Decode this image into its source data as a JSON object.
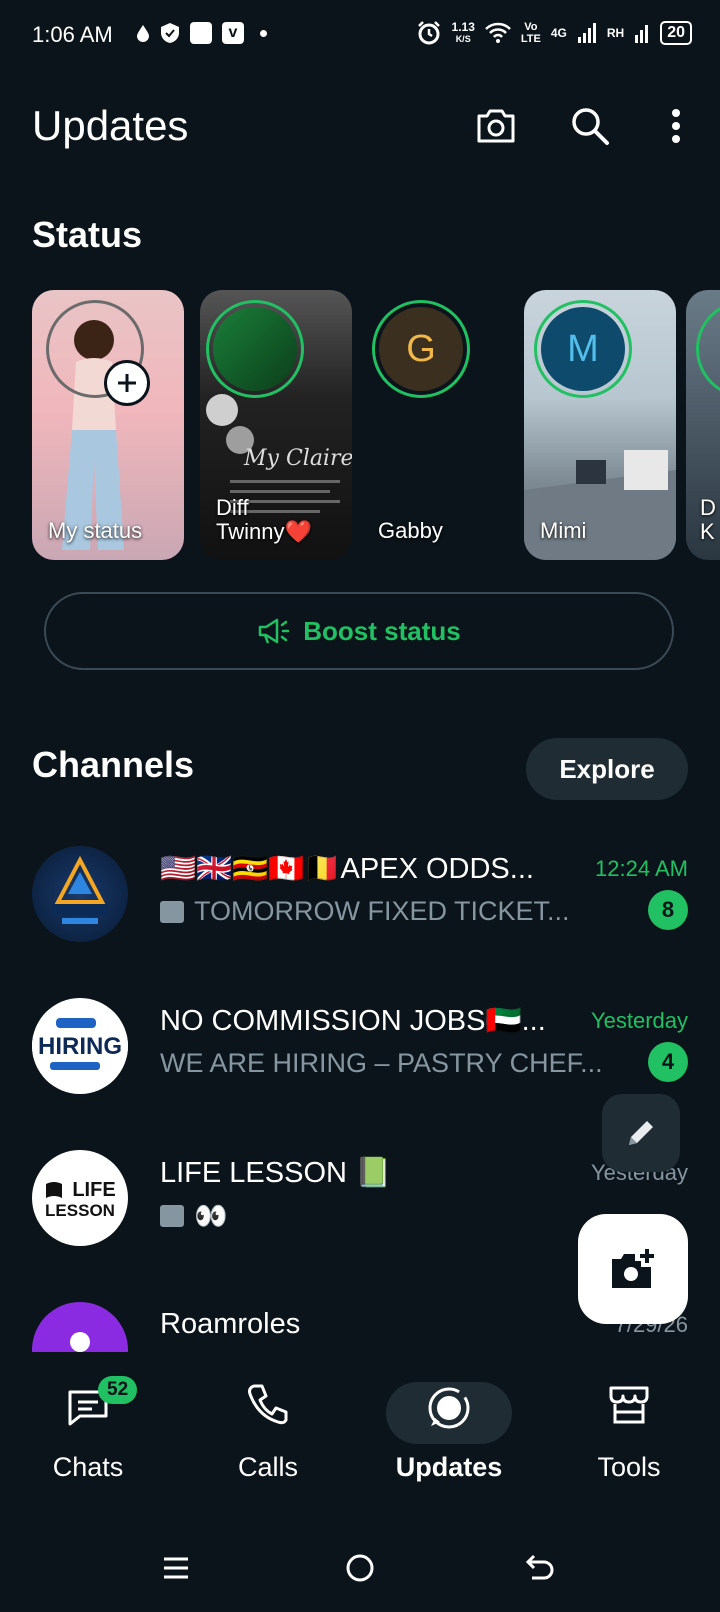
{
  "status_bar": {
    "time": "1:06 AM",
    "speed": "1.13",
    "speed_unit": "K/S",
    "volte_top": "Vo",
    "volte_bottom": "LTE",
    "network": "4G",
    "network2": "RH",
    "battery": "20"
  },
  "header": {
    "title": "Updates"
  },
  "status": {
    "heading": "Status",
    "items": [
      {
        "label": "My status"
      },
      {
        "label": "Diff\nTwinny❤️"
      },
      {
        "label": "Gabby",
        "initial": "G"
      },
      {
        "label": "Mimi",
        "initial": "M"
      },
      {
        "label": "D\nK"
      }
    ],
    "boost_label": "Boost status"
  },
  "channels": {
    "heading": "Channels",
    "explore_label": "Explore",
    "items": [
      {
        "name": "🇺🇸🇬🇧🇺🇬🇨🇦🇧🇪APEX ODDS...",
        "message": "TOMORROW FIXED TICKET...",
        "time": "12:24 AM",
        "unread": "8"
      },
      {
        "name": "NO COMMISSION JOBS🇦🇪...",
        "message": "WE ARE HIRING – PASTRY CHEF...",
        "time": "Yesterday",
        "unread": "4"
      },
      {
        "name": "LIFE LESSON 📗",
        "message": "👀",
        "time": "Yesterday"
      },
      {
        "name": "Roamroles",
        "time": "7/29/26"
      }
    ]
  },
  "nav": {
    "chats": "Chats",
    "chats_badge": "52",
    "calls": "Calls",
    "updates": "Updates",
    "tools": "Tools"
  },
  "colors": {
    "background": "#0b141a",
    "accent": "#21c063",
    "surface": "#1f2c34",
    "secondary_text": "#8696a0"
  }
}
